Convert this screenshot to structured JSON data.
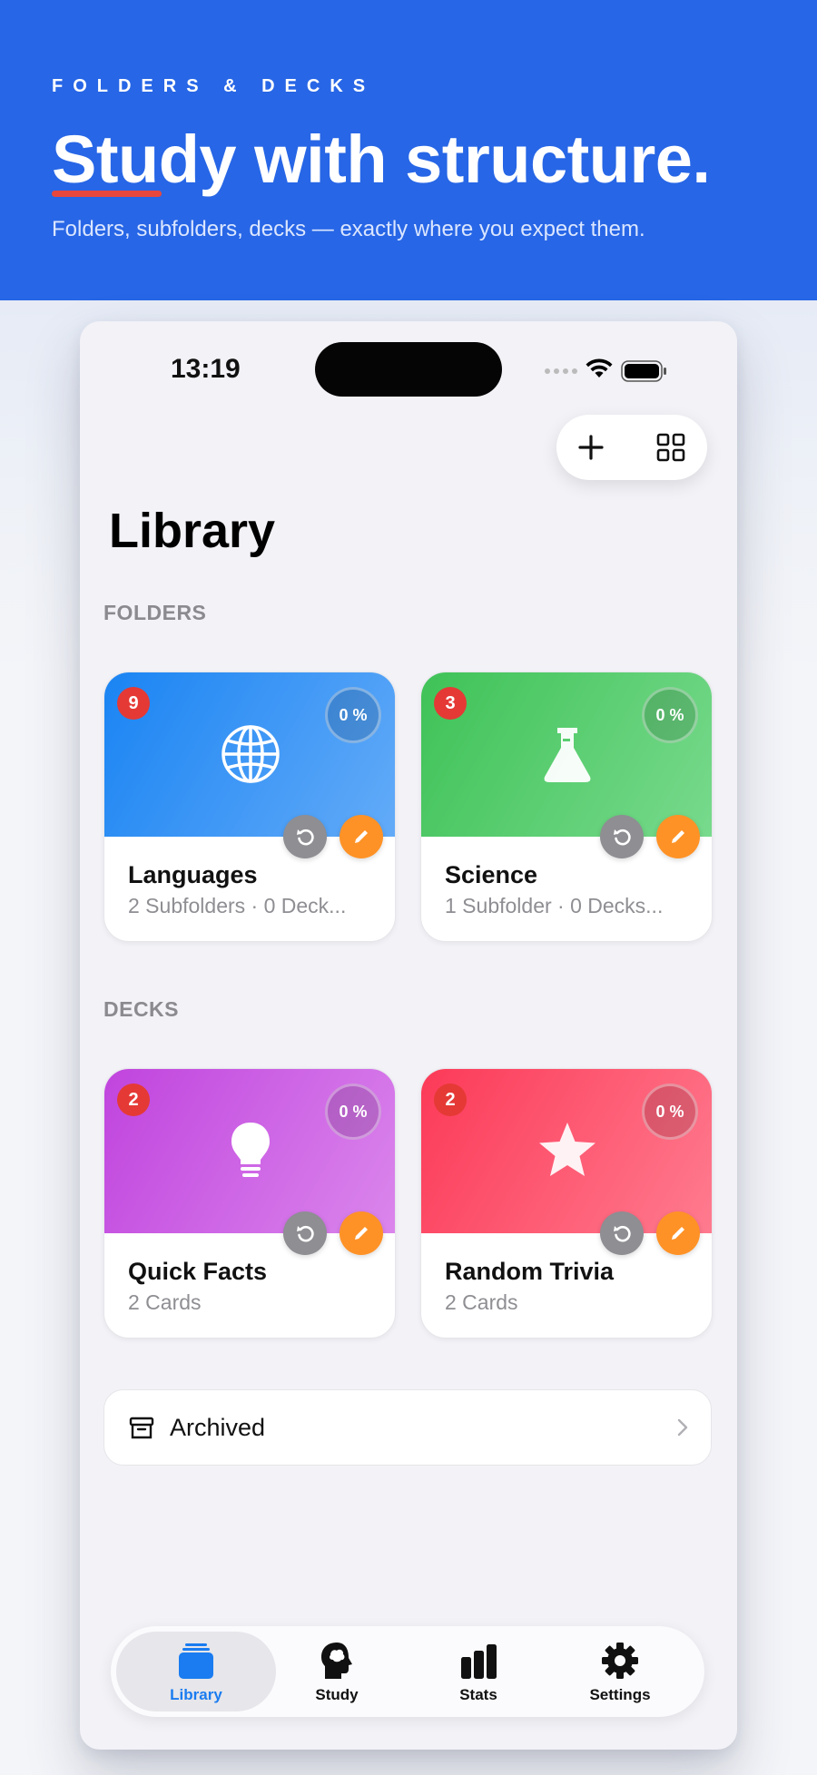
{
  "hero": {
    "eyebrow": "FOLDERS & DECKS",
    "headline": "Study with structure.",
    "subhead": "Folders, subfolders, decks — exactly where you expect them."
  },
  "status_bar": {
    "time": "13:19"
  },
  "toolbar": {
    "add_icon": "plus-icon",
    "layout_icon": "grid-icon"
  },
  "library": {
    "title": "Library",
    "folders_label": "FOLDERS",
    "decks_label": "DECKS",
    "folders": [
      {
        "name": "Languages",
        "meta": "2 Subfolders · 0 Deck...",
        "badge": "9",
        "progress": "0 %",
        "icon": "globe-icon",
        "color": "#1a84f3"
      },
      {
        "name": "Science",
        "meta": "1 Subfolder · 0 Decks...",
        "badge": "3",
        "progress": "0 %",
        "icon": "flask-icon",
        "color": "#3fc257"
      }
    ],
    "decks": [
      {
        "name": "Quick Facts",
        "meta": "2 Cards",
        "badge": "2",
        "progress": "0 %",
        "icon": "lightbulb-icon",
        "color": "#c044de"
      },
      {
        "name": "Random Trivia",
        "meta": "2 Cards",
        "badge": "2",
        "progress": "0 %",
        "icon": "star-icon",
        "color": "#fc3a58"
      }
    ],
    "archived_label": "Archived"
  },
  "tabs": [
    {
      "label": "Library",
      "icon": "library-stack-icon",
      "active": true
    },
    {
      "label": "Study",
      "icon": "brain-head-icon",
      "active": false
    },
    {
      "label": "Stats",
      "icon": "bar-chart-icon",
      "active": false
    },
    {
      "label": "Settings",
      "icon": "gear-icon",
      "active": false
    }
  ],
  "colors": {
    "hero_blue": "#2766e6",
    "accent": "#1a7cf0",
    "badge_red": "#e53935",
    "edit_orange": "#ff9226",
    "reset_gray": "#8e8e93"
  }
}
